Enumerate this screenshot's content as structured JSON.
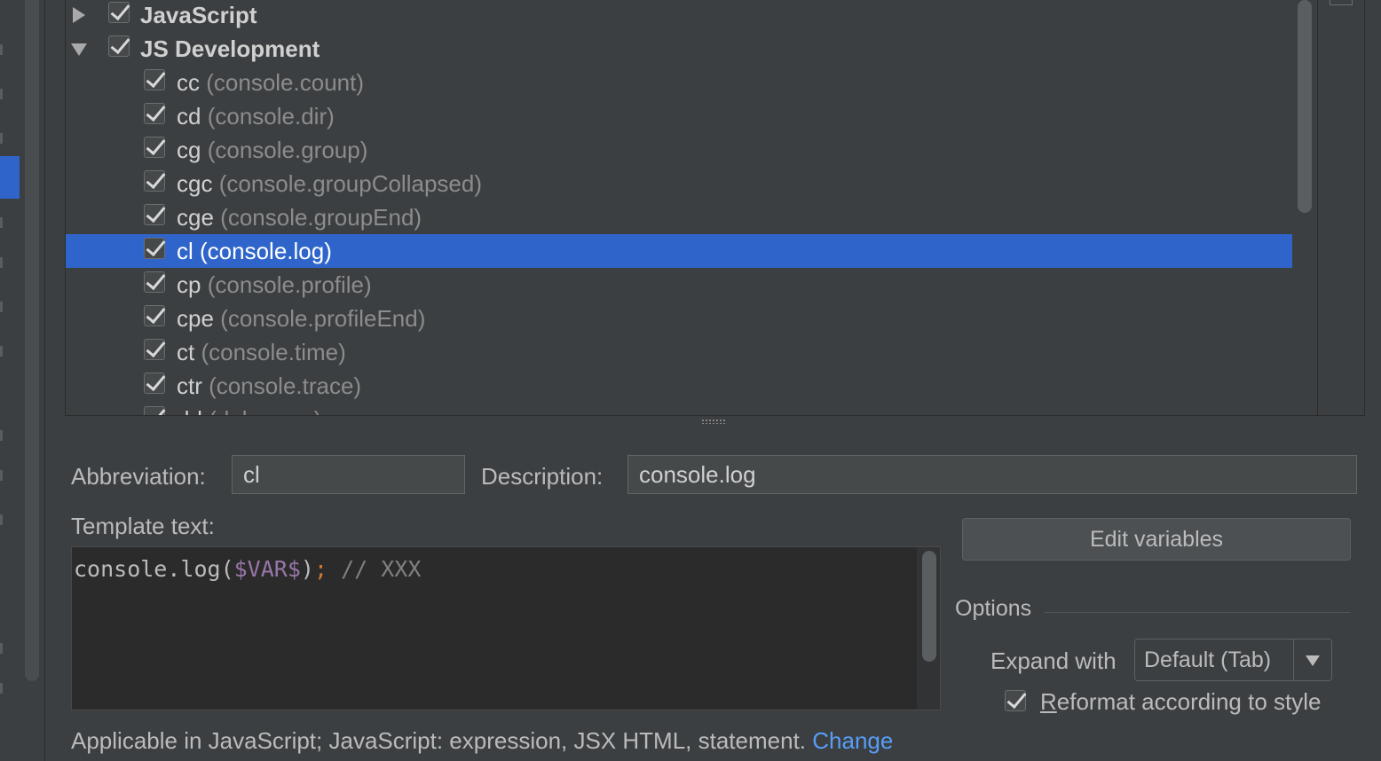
{
  "tree": {
    "groups": [
      {
        "label": "JavaScript",
        "expanded": false,
        "checked": true
      },
      {
        "label": "JS Development",
        "expanded": true,
        "checked": true
      }
    ],
    "items": [
      {
        "abbr": "cc",
        "desc": "(console.count)"
      },
      {
        "abbr": "cd",
        "desc": "(console.dir)"
      },
      {
        "abbr": "cg",
        "desc": "(console.group)"
      },
      {
        "abbr": "cgc",
        "desc": "(console.groupCollapsed)"
      },
      {
        "abbr": "cge",
        "desc": "(console.groupEnd)"
      },
      {
        "abbr": "cl",
        "desc": "(console.log)",
        "selected": true
      },
      {
        "abbr": "cp",
        "desc": "(console.profile)"
      },
      {
        "abbr": "cpe",
        "desc": "(console.profileEnd)"
      },
      {
        "abbr": "ct",
        "desc": "(console.time)"
      },
      {
        "abbr": "ctr",
        "desc": "(console.trace)"
      },
      {
        "abbr": "dd",
        "desc": "(debugger)"
      }
    ]
  },
  "form": {
    "abbreviation_label": "Abbreviation:",
    "abbreviation_value": "cl",
    "description_label": "Description:",
    "description_value": "console.log",
    "template_label": "Template text:",
    "template_code": {
      "fn": "console.log(",
      "var": "$VAR$",
      "close": ")",
      "semi": ";",
      "comment": "// XXX"
    },
    "edit_variables_label": "Edit variables",
    "options_label": "Options",
    "expand_with_label": "Expand with",
    "expand_with_value": "Default (Tab)",
    "reformat_mnemonic": "R",
    "reformat_rest": "eformat according to style",
    "reformat_checked": true,
    "applicable_text": "Applicable in JavaScript; JavaScript: expression, JSX HTML, statement.",
    "change_link": "Change"
  },
  "colors": {
    "selection": "#2f65ca",
    "link": "#589df6",
    "background": "#3c3f41",
    "editor_background": "#2b2b2b"
  },
  "icons": [
    "tree-expand-arrow-icon",
    "tree-collapse-arrow-icon",
    "checkbox-checked-icon",
    "dropdown-arrow-icon",
    "splitter-grip-icon"
  ]
}
